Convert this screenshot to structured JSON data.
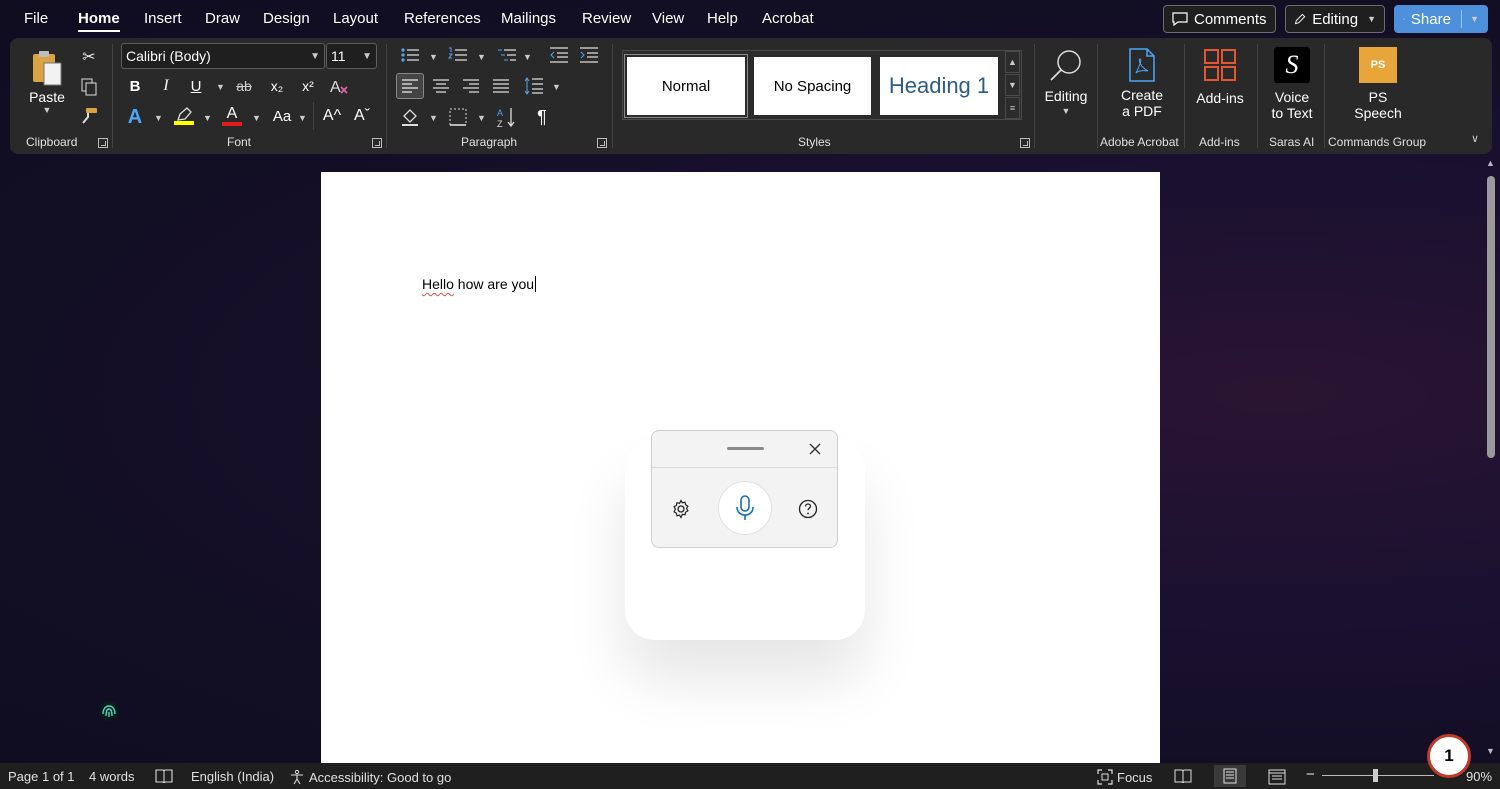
{
  "menu": {
    "tabs": [
      "File",
      "Home",
      "Insert",
      "Draw",
      "Design",
      "Layout",
      "References",
      "Mailings",
      "Review",
      "View",
      "Help",
      "Acrobat"
    ],
    "active": "Home",
    "comments_label": "Comments",
    "editing_label": "Editing",
    "share_label": "Share"
  },
  "ribbon": {
    "clipboard": {
      "paste_label": "Paste",
      "group_label": "Clipboard"
    },
    "font": {
      "font_name": "Calibri (Body)",
      "font_size": "11",
      "bold": "B",
      "italic": "I",
      "underline": "U",
      "strike": "ab",
      "subscript": "x₂",
      "superscript": "x²",
      "case_label": "Aa",
      "grow": "A^",
      "shrink": "Aˇ",
      "group_label": "Font"
    },
    "paragraph": {
      "group_label": "Paragraph",
      "pilcrow": "¶"
    },
    "styles": {
      "normal": "Normal",
      "no_spacing": "No Spacing",
      "heading1": "Heading 1",
      "group_label": "Styles"
    },
    "editing": {
      "label": "Editing"
    },
    "acrobat": {
      "line1": "Create",
      "line2": "a PDF",
      "group_label": "Adobe Acrobat"
    },
    "addins": {
      "label": "Add-ins",
      "group_label": "Add-ins"
    },
    "saras": {
      "line1": "Voice",
      "line2": "to Text",
      "group_label": "Saras AI",
      "logo": "S"
    },
    "commands": {
      "line1": "PS",
      "line2": "Speech",
      "group_label": "Commands Group",
      "logo": "PS"
    }
  },
  "document": {
    "word1": "Hello",
    "rest": " how are you"
  },
  "status": {
    "page": "Page 1 of 1",
    "words": "4 words",
    "language": "English (India)",
    "accessibility": "Accessibility: Good to go",
    "focus": "Focus",
    "zoom": "90%"
  },
  "badge": "1",
  "colors": {
    "share": "#4e8fdc",
    "highlight": "#ffff00",
    "font_color": "#e31b1b",
    "accent_blue": "#4ea6f5"
  }
}
